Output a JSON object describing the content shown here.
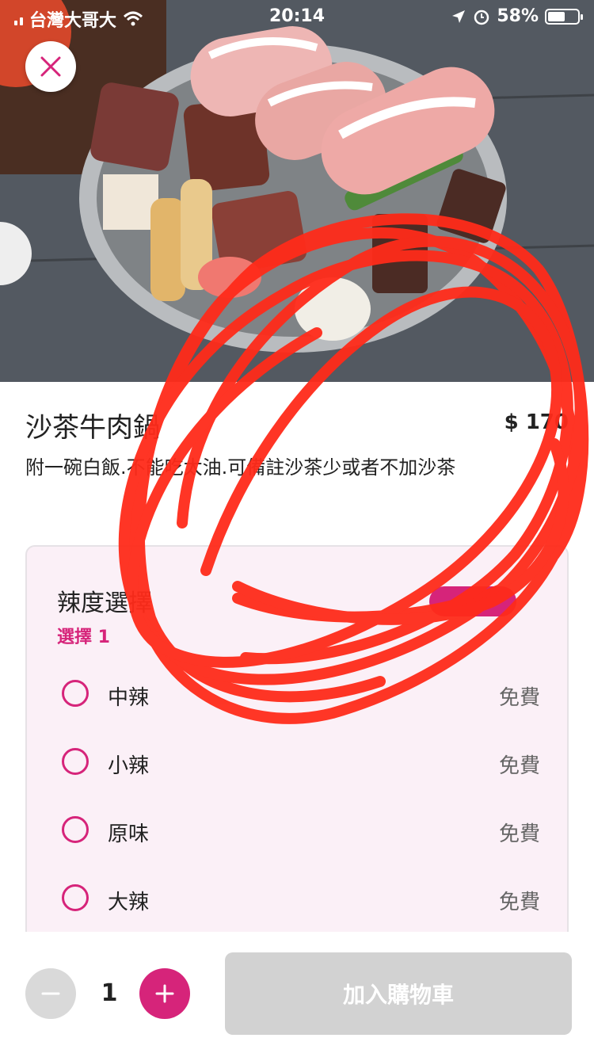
{
  "status_bar": {
    "carrier": "台灣大哥大",
    "time": "20:14",
    "battery": "58%",
    "battery_level": 0.58
  },
  "dish": {
    "name": "沙茶牛肉鍋",
    "price": "$ 170",
    "description": "附一碗白飯.不能吃太油.可備註沙茶少或者不加沙茶"
  },
  "options": {
    "title": "辣度選擇",
    "subtitle": "選擇 1",
    "items": [
      {
        "label": "中辣",
        "price": "免費"
      },
      {
        "label": "小辣",
        "price": "免費"
      },
      {
        "label": "原味",
        "price": "免費"
      },
      {
        "label": "大辣",
        "price": "免費"
      }
    ]
  },
  "cart": {
    "quantity": "1",
    "add_label": "加入購物車"
  },
  "colors": {
    "accent": "#d6247a",
    "scribble": "#ff2b1a",
    "disabled_button": "#d2d2d2"
  }
}
